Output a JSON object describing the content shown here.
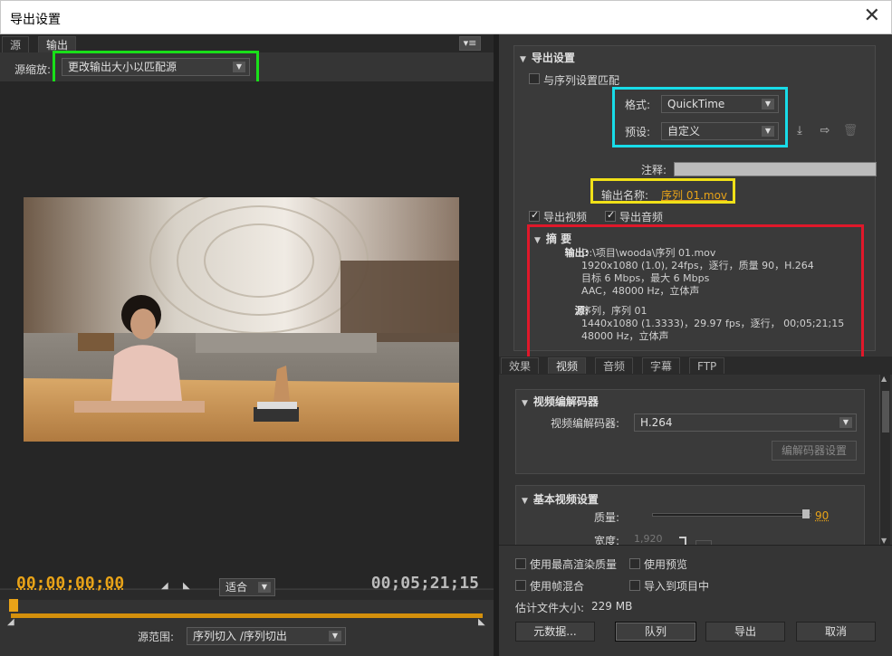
{
  "window": {
    "title": "导出设置",
    "close_glyph": "✕"
  },
  "left": {
    "tabs": [
      "源",
      "输出"
    ],
    "panel_menu_glyph": "▾≡",
    "source_scale_label": "源缩放:",
    "source_scale_value": "更改输出大小以匹配源",
    "preview_image": "woman-sitting-at-table-with-wooden-hand-model",
    "timecode_in": "00;00;00;00",
    "timecode_out": "00;05;21;15",
    "fit_value": "适合",
    "range_label": "源范围:",
    "range_value": "序列切入 /序列切出"
  },
  "export": {
    "title": "导出设置",
    "match_sequence_label": "与序列设置匹配",
    "format_label": "格式:",
    "format_value": "QuickTime",
    "preset_label": "预设:",
    "preset_value": "自定义",
    "comment_label": "注释:",
    "comment_value": "",
    "output_name_label": "输出名称:",
    "output_name_value": "序列 01.mov",
    "export_video_label": "导出视频",
    "export_audio_label": "导出音频",
    "summary_title": "摘 要",
    "summary": {
      "output_label": "输出:",
      "output_lines": [
        "D:\\项目\\wooda\\序列 01.mov",
        "1920x1080 (1.0), 24fps，逐行，质量 90，H.264",
        "目标 6 Mbps，最大 6 Mbps",
        "AAC，48000 Hz，立体声"
      ],
      "source_label": "源:",
      "source_lines": [
        "序列，序列 01",
        "1440x1080 (1.3333)，29.97 fps，逐行， 00;05;21;15",
        "48000 Hz，立体声"
      ]
    }
  },
  "settings_tabs": [
    "效果",
    "视频",
    "音频",
    "字幕",
    "FTP"
  ],
  "video": {
    "codec_section_title": "视频编解码器",
    "codec_label": "视频编解码器:",
    "codec_value": "H.264",
    "codec_settings_button": "编解码器设置",
    "basic_section_title": "基本视频设置",
    "quality_label": "质量:",
    "quality_value": "90",
    "quality": 0.9,
    "width_label": "宽度:",
    "width_value": "1,920"
  },
  "options": {
    "max_render_quality": "使用最高渲染质量",
    "use_previews": "使用预览",
    "frame_blending": "使用帧混合",
    "import_into_project": "导入到项目中",
    "estimated_size_label": "估计文件大小:",
    "estimated_size_value": "229 MB"
  },
  "buttons": {
    "metadata": "元数据...",
    "queue": "队列",
    "export": "导出",
    "cancel": "取消"
  },
  "colors": {
    "accent_orange": "#e8a318",
    "highlight_green": "#19e019",
    "highlight_cyan": "#18dce8",
    "highlight_yellow": "#f0e018",
    "highlight_red": "#e0182a"
  }
}
